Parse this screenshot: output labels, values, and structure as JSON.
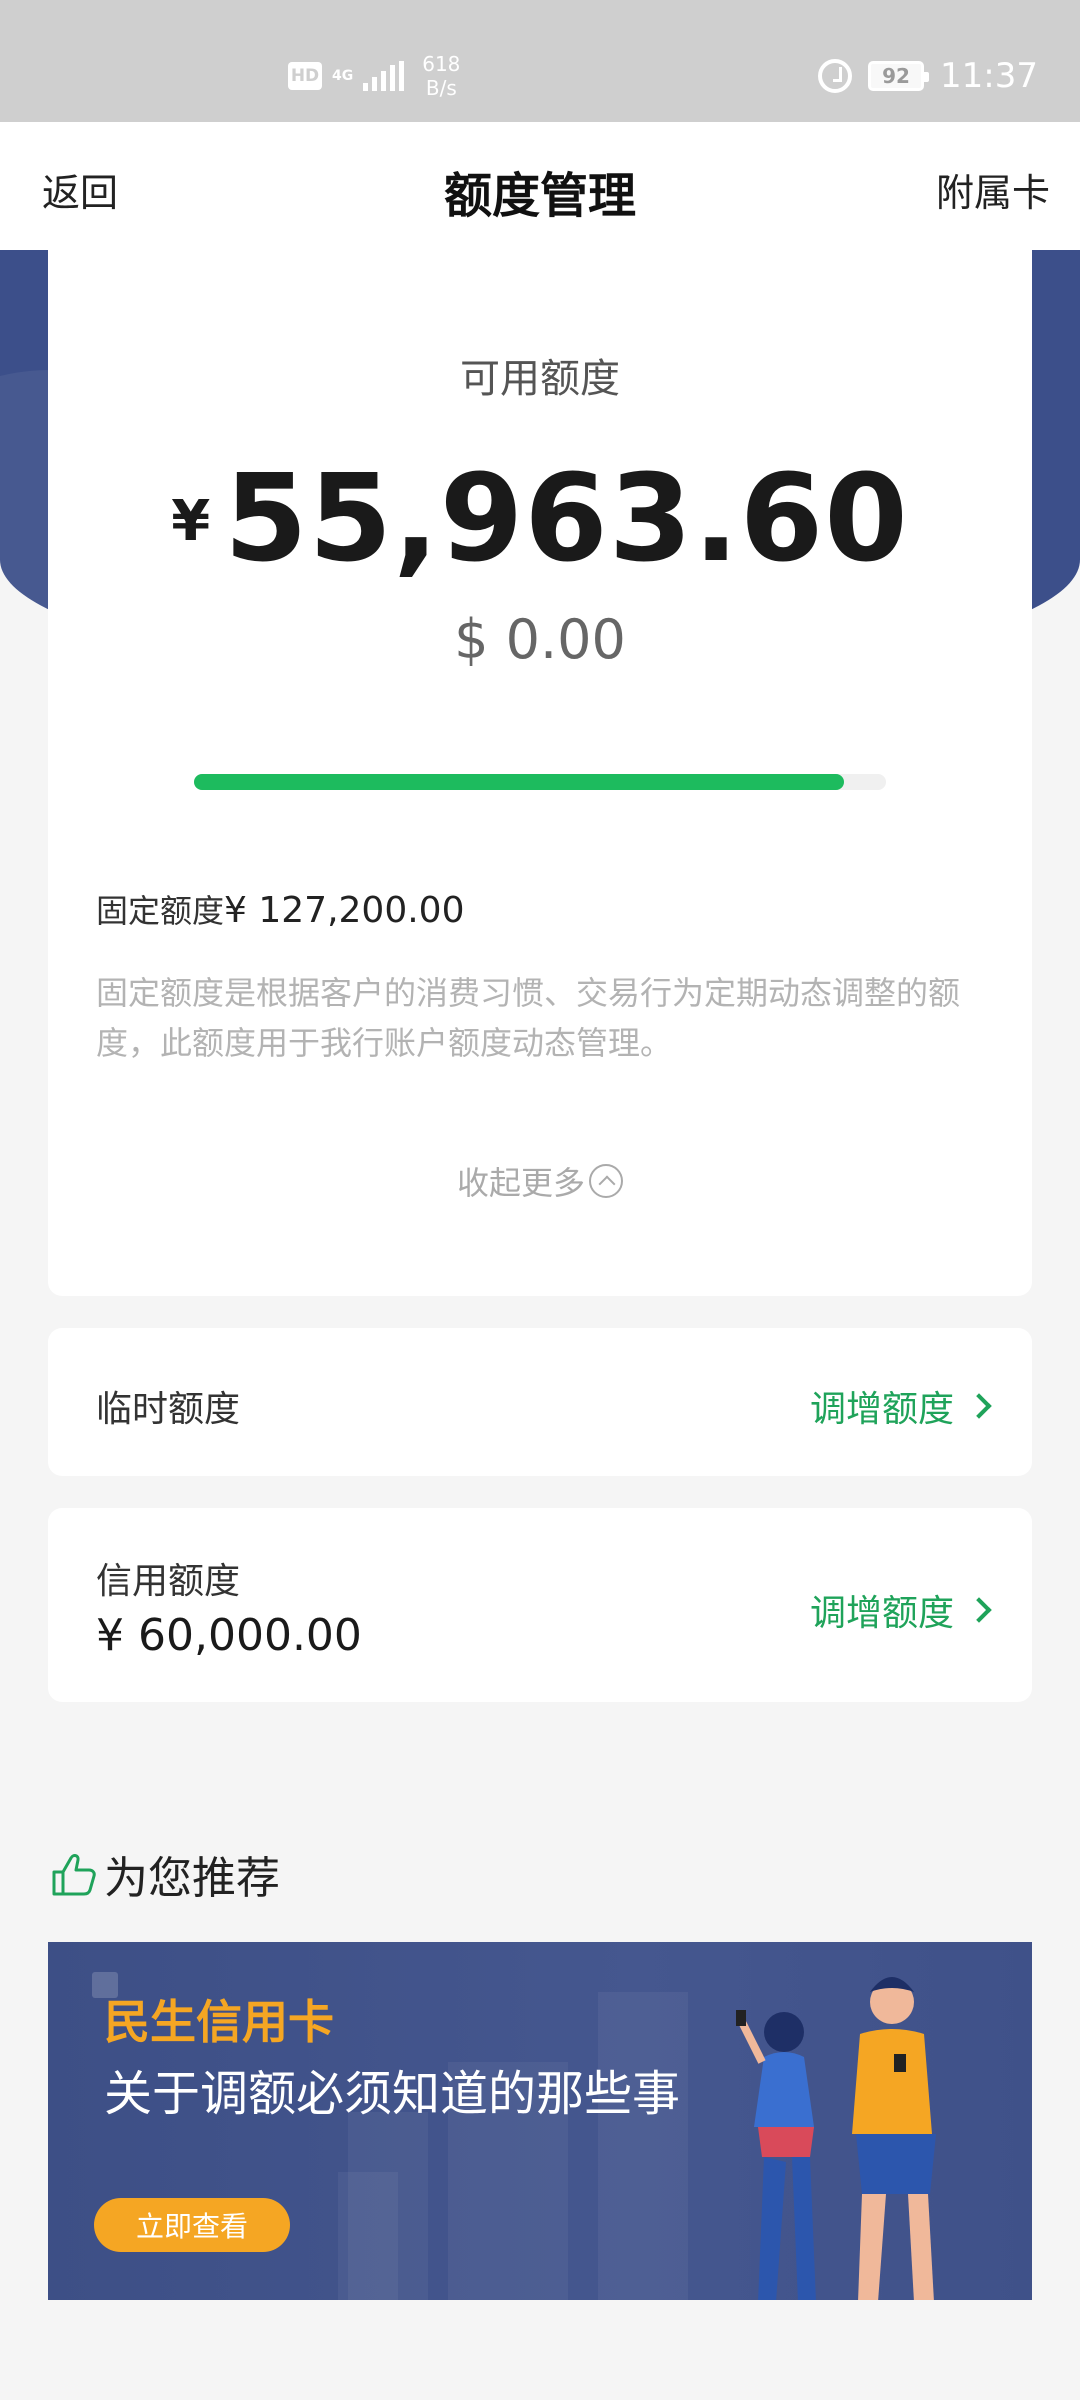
{
  "status_bar": {
    "hd": "HD",
    "network": "4G",
    "speed_value": "618",
    "speed_unit": "B/s",
    "battery": "92",
    "time": "11:37"
  },
  "nav": {
    "back": "返回",
    "title": "额度管理",
    "right": "附属卡"
  },
  "available": {
    "label": "可用额度",
    "currency_symbol": "¥",
    "amount": "55,963.60",
    "usd_amount": "$ 0.00",
    "usage_fraction": 0.94
  },
  "fixed": {
    "label": "固定额度",
    "amount": "¥ 127,200.00",
    "description": "固定额度是根据客户的消费习惯、交易行为定期动态调整的额度，此额度用于我行账户额度动态管理。",
    "collapse_label": "收起更多"
  },
  "temporary": {
    "title": "临时额度",
    "action": "调增额度"
  },
  "credit": {
    "title": "信用额度",
    "amount": "¥ 60,000.00",
    "action": "调增额度"
  },
  "recommend": {
    "title": "为您推荐",
    "banner_brand": "民生信用卡",
    "banner_subtitle": "关于调额必须知道的那些事",
    "banner_button": "立即查看"
  },
  "colors": {
    "accent_green": "#1fa35a",
    "progress_green": "#1dbb5e",
    "header_blue": "#3c4f8a",
    "banner_orange": "#f5a623"
  },
  "icons": [
    "alarm-icon",
    "battery-icon",
    "signal-icon",
    "chevron-up-icon",
    "chevron-right-icon",
    "thumbs-up-icon"
  ]
}
